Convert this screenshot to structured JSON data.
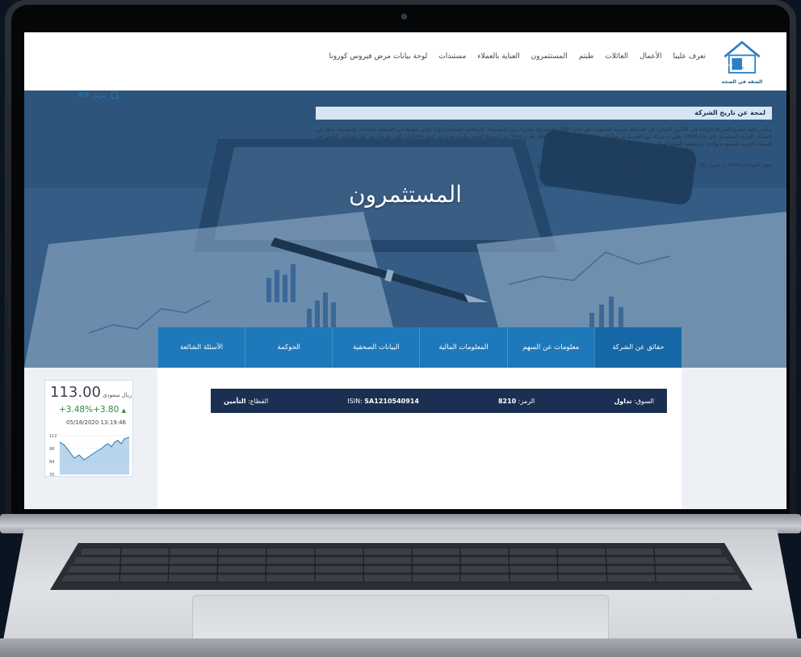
{
  "header": {
    "logo_tagline": "الشقة في الصحة",
    "nav": [
      "تعرف علينا",
      "الأعمال",
      "العائلات",
      "طبتم",
      "المستثمرون",
      "العناية بالعملاء",
      "مستندات",
      "لوحة بيانات مرض فيروس كورونا"
    ]
  },
  "hero": {
    "title": "المستثمرون"
  },
  "tabs": [
    "حقائق عن الشركة",
    "معلومات عن السهم",
    "المعلومات المالية",
    "البيانات الصحفية",
    "الحوكمة",
    "الأسئلة الشائعة"
  ],
  "infobar": {
    "market_label": "السوق:",
    "market_value": "تداول",
    "symbol_label": "الرمز:",
    "symbol_value": "8210",
    "isin_label": "ISIN:",
    "isin_value": "SA1210540914",
    "sector_label": "القطاع:",
    "sector_value": "التأمين"
  },
  "pdf_link": "تنزيل PDF",
  "section": {
    "title": "لمحة عن تاريخ الشركة",
    "paragraph": "بدأت رحلتنا لنصبح الشركة الرائدة في التأمين الصحي في المملكة العربية السعودية في عام 1997، كمشروع مشترك بين المجموعة البريطانية المتحدة (بوبا) والتي مقرها في المملكة المتحدة، ومجموعة ناظر من المملكة العربية السعودية. في عام 2008 تطورت شركة بوبا العربية تدريجياً إلى شركة مساهمة عامة من خلال طرح 40% من أسهمها للعامة والذي يعتبر من انجح الاكتتابات التي طرحت من قبل شركات التأمين في المملكة العربية السعودية والذي تم بتغطية المبلغ المطلوب بنسبة تجاوزت 900%.",
    "paragraph2": "يتوفر اليوم لدينا 1,200 مليون ريال كرأس مال المصرح به والمدفوع كاملاً ، والذي يشكل 120 مليون سهم مدرج."
  },
  "stock": {
    "price": "113.00",
    "currency": "ريال سعودي",
    "change": "+3.48%+3.80",
    "arrow": "▲",
    "timestamp": "05/18/2020  13:19:46",
    "y_ticks": [
      "112",
      "98",
      "84",
      "70"
    ]
  },
  "colors": {
    "accent": "#1e79bb",
    "dark_bar": "#1b2f52",
    "positive": "#2e8b3a"
  }
}
